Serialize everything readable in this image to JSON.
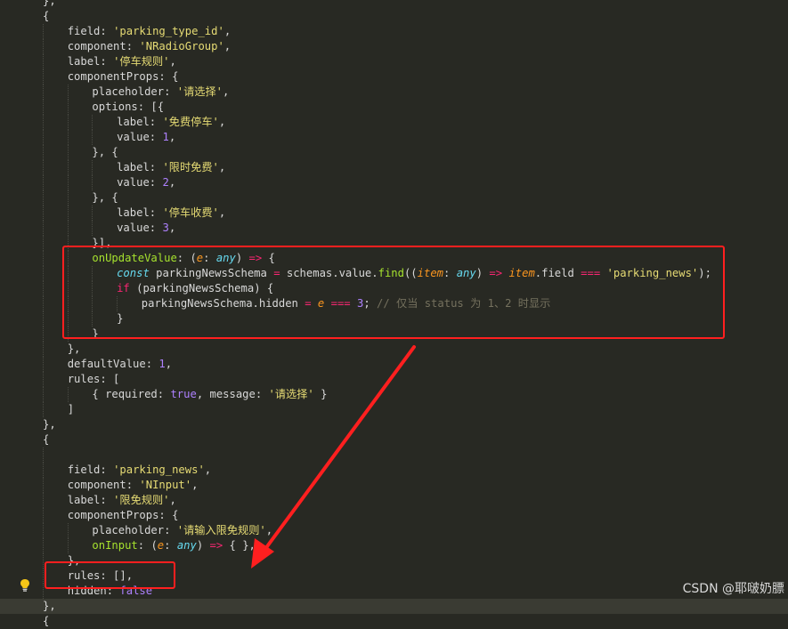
{
  "code_lines": [
    [
      [
        "p",
        "},"
      ]
    ],
    [
      [
        "p",
        "{"
      ]
    ],
    [
      [
        "p",
        "field: "
      ],
      [
        "s",
        "'parking_type_id'"
      ],
      [
        "p",
        ","
      ]
    ],
    [
      [
        "p",
        "component: "
      ],
      [
        "s",
        "'NRadioGroup'"
      ],
      [
        "p",
        ","
      ]
    ],
    [
      [
        "p",
        "label: "
      ],
      [
        "s",
        "'停车规则'"
      ],
      [
        "p",
        ","
      ]
    ],
    [
      [
        "p",
        "componentProps: {"
      ]
    ],
    [
      [
        "p",
        "placeholder: "
      ],
      [
        "s",
        "'请选择'"
      ],
      [
        "p",
        ","
      ]
    ],
    [
      [
        "p",
        "options: [{"
      ]
    ],
    [
      [
        "p",
        "label: "
      ],
      [
        "s",
        "'免费停车'"
      ],
      [
        "p",
        ","
      ]
    ],
    [
      [
        "p",
        "value: "
      ],
      [
        "n",
        "1"
      ],
      [
        "p",
        ","
      ]
    ],
    [
      [
        "p",
        "}, {"
      ]
    ],
    [
      [
        "p",
        "label: "
      ],
      [
        "s",
        "'限时免费'"
      ],
      [
        "p",
        ","
      ]
    ],
    [
      [
        "p",
        "value: "
      ],
      [
        "n",
        "2"
      ],
      [
        "p",
        ","
      ]
    ],
    [
      [
        "p",
        "}, {"
      ]
    ],
    [
      [
        "p",
        "label: "
      ],
      [
        "s",
        "'停车收费'"
      ],
      [
        "p",
        ","
      ]
    ],
    [
      [
        "p",
        "value: "
      ],
      [
        "n",
        "3"
      ],
      [
        "p",
        ","
      ]
    ],
    [
      [
        "p",
        "}],"
      ]
    ],
    [
      [
        "f",
        "onUpdateValue"
      ],
      [
        "p",
        ": ("
      ],
      [
        "a",
        "e"
      ],
      [
        "p",
        ": "
      ],
      [
        "t",
        "any"
      ],
      [
        "p",
        ") "
      ],
      [
        "kw",
        "=>"
      ],
      [
        "p",
        " {"
      ]
    ],
    [
      [
        "k",
        "const"
      ],
      [
        "p",
        " parkingNewsSchema "
      ],
      [
        "kw",
        "="
      ],
      [
        "p",
        " schemas.value."
      ],
      [
        "f",
        "find"
      ],
      [
        "p",
        "(("
      ],
      [
        "a",
        "item"
      ],
      [
        "p",
        ": "
      ],
      [
        "t",
        "any"
      ],
      [
        "p",
        ") "
      ],
      [
        "kw",
        "=>"
      ],
      [
        "p",
        " "
      ],
      [
        "a",
        "item"
      ],
      [
        "p",
        ".field "
      ],
      [
        "kw",
        "==="
      ],
      [
        "p",
        " "
      ],
      [
        "s",
        "'parking_news'"
      ],
      [
        "p",
        ");"
      ]
    ],
    [
      [
        "kw",
        "if"
      ],
      [
        "p",
        " (parkingNewsSchema) {"
      ]
    ],
    [
      [
        "p",
        "parkingNewsSchema.hidden "
      ],
      [
        "kw",
        "="
      ],
      [
        "p",
        " "
      ],
      [
        "a",
        "e"
      ],
      [
        "p",
        " "
      ],
      [
        "kw",
        "==="
      ],
      [
        "p",
        " "
      ],
      [
        "n",
        "3"
      ],
      [
        "p",
        "; "
      ],
      [
        "c",
        "// 仅当 status 为 1、2 时显示"
      ]
    ],
    [
      [
        "p",
        "}"
      ]
    ],
    [
      [
        "p",
        "}"
      ]
    ],
    [
      [
        "p",
        "},"
      ]
    ],
    [
      [
        "p",
        "defaultValue: "
      ],
      [
        "n",
        "1"
      ],
      [
        "p",
        ","
      ]
    ],
    [
      [
        "p",
        "rules: ["
      ]
    ],
    [
      [
        "p",
        "{ required: "
      ],
      [
        "n",
        "true"
      ],
      [
        "p",
        ", message: "
      ],
      [
        "s",
        "'请选择'"
      ],
      [
        "p",
        " }"
      ]
    ],
    [
      [
        "p",
        "]"
      ]
    ],
    [
      [
        "p",
        "},"
      ]
    ],
    [
      [
        "p",
        "{"
      ]
    ],
    [
      [
        "p",
        ""
      ]
    ],
    [
      [
        "p",
        "field: "
      ],
      [
        "s",
        "'parking_news'"
      ],
      [
        "p",
        ","
      ]
    ],
    [
      [
        "p",
        "component: "
      ],
      [
        "s",
        "'NInput'"
      ],
      [
        "p",
        ","
      ]
    ],
    [
      [
        "p",
        "label: "
      ],
      [
        "s",
        "'限免规则'"
      ],
      [
        "p",
        ","
      ]
    ],
    [
      [
        "p",
        "componentProps: {"
      ]
    ],
    [
      [
        "p",
        "placeholder: "
      ],
      [
        "s",
        "'请输入限免规则'"
      ],
      [
        "p",
        ","
      ]
    ],
    [
      [
        "f",
        "onInput"
      ],
      [
        "p",
        ": ("
      ],
      [
        "a",
        "e"
      ],
      [
        "p",
        ": "
      ],
      [
        "t",
        "any"
      ],
      [
        "p",
        ") "
      ],
      [
        "kw",
        "=>"
      ],
      [
        "p",
        " { },"
      ]
    ],
    [
      [
        "p",
        "},"
      ]
    ],
    [
      [
        "p",
        "rules: [],"
      ]
    ],
    [
      [
        "p",
        "hidden: "
      ],
      [
        "n",
        "false"
      ]
    ],
    [
      [
        "p",
        "},"
      ]
    ],
    [
      [
        "p",
        "{"
      ]
    ]
  ],
  "watermark": "CSDN @耶啵奶膘",
  "colors": {
    "background": "#282923",
    "highlight_box": "#ff1f1f",
    "string": "#e6db74",
    "number": "#ae81ff",
    "function": "#a6e22e",
    "keyword": "#f92672",
    "comment": "#75715e"
  },
  "icons": [
    "lightbulb-icon"
  ]
}
